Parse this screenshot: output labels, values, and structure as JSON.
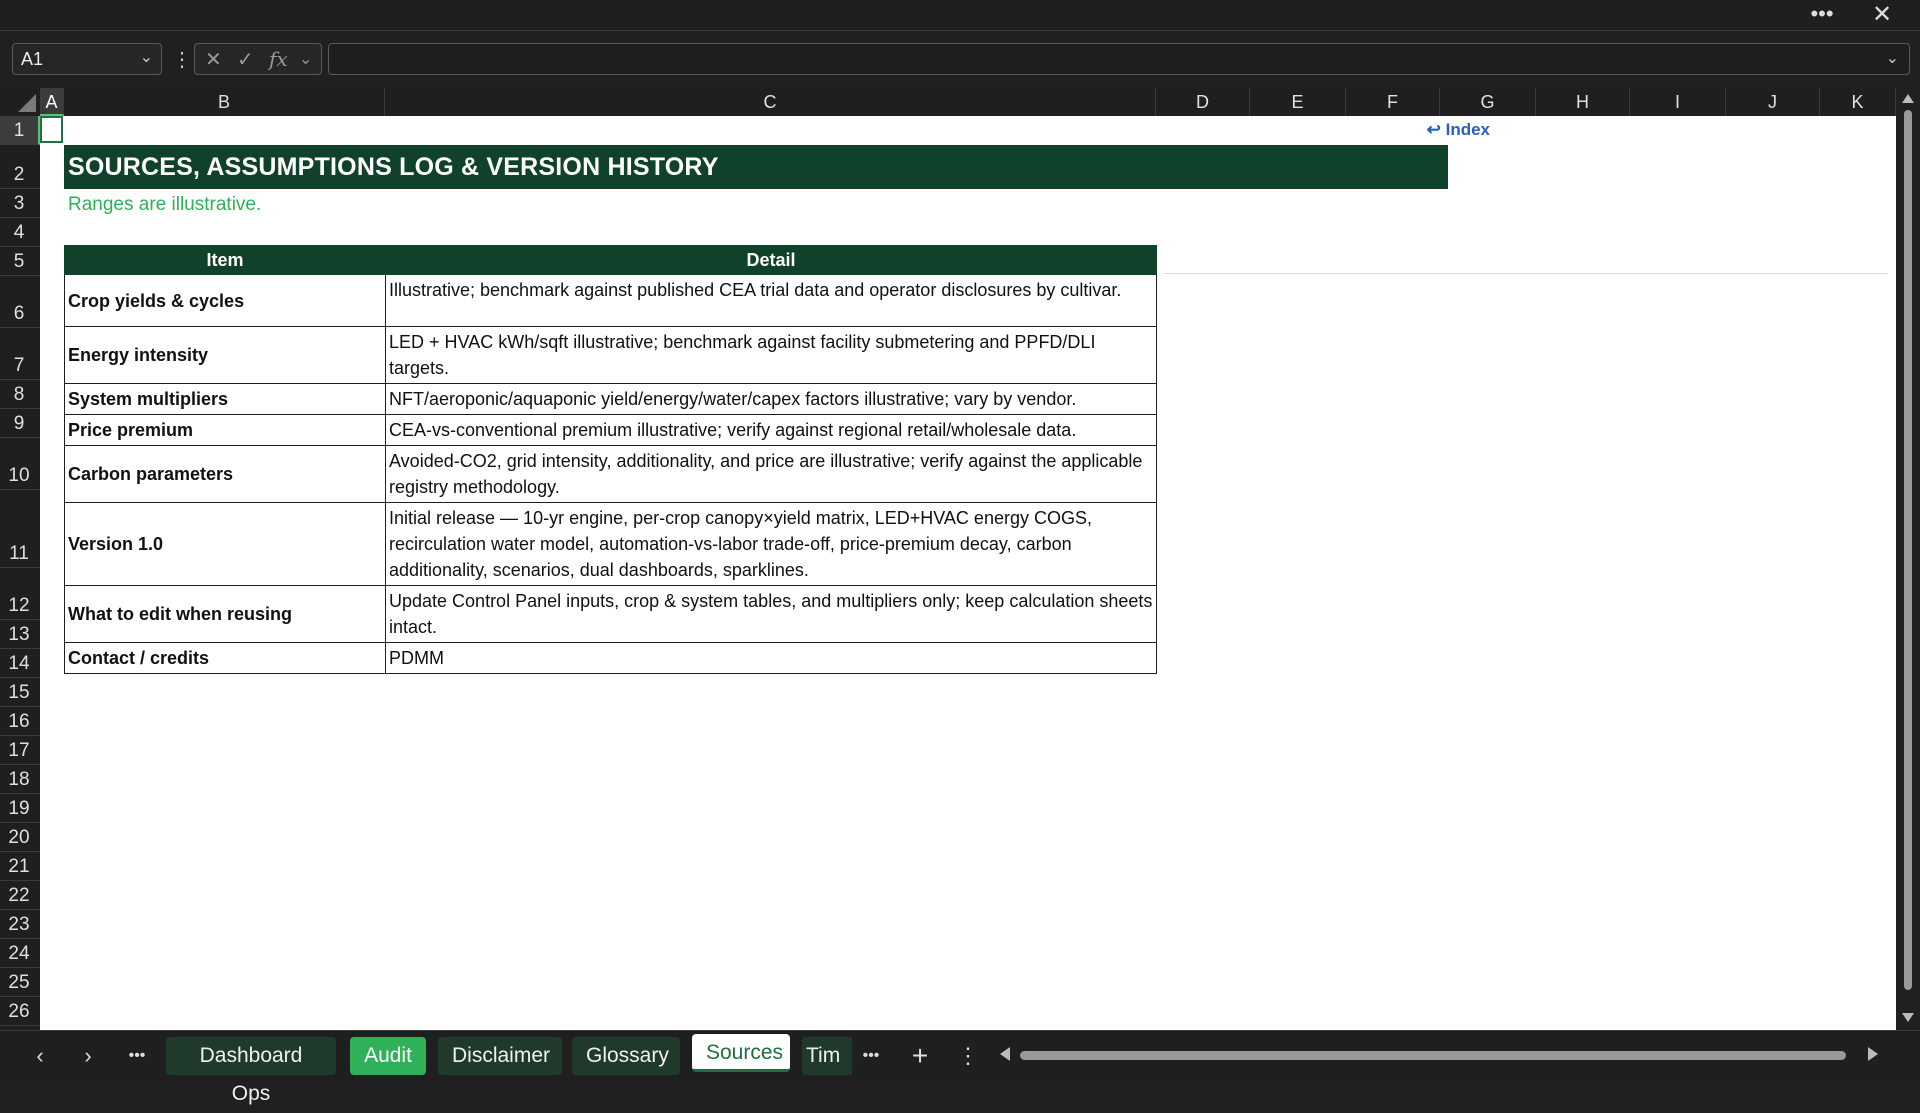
{
  "window": {
    "more_label": "•••",
    "close_label": "✕"
  },
  "formula_bar": {
    "name_box": "A1",
    "cancel_icon": "✕",
    "enter_icon": "✓",
    "fx_label": "fx",
    "formula": ""
  },
  "columns": [
    "A",
    "B",
    "C",
    "D",
    "E",
    "F",
    "G",
    "H",
    "I",
    "J",
    "K"
  ],
  "rows": [
    "1",
    "2",
    "3",
    "4",
    "5",
    "6",
    "7",
    "8",
    "9",
    "10",
    "11",
    "12",
    "13",
    "14",
    "15",
    "16",
    "17",
    "18",
    "19",
    "20",
    "21",
    "22",
    "23",
    "24",
    "25",
    "26"
  ],
  "sheet": {
    "index_link": "↩ Index",
    "title": "SOURCES, ASSUMPTIONS LOG & VERSION HISTORY",
    "subtitle": "Ranges are illustrative.",
    "table": {
      "headers": [
        "Item",
        "Detail"
      ],
      "rows": [
        {
          "item": "Crop yields & cycles",
          "detail": "Illustrative; benchmark against published CEA trial data and operator disclosures by cultivar."
        },
        {
          "item": "Energy intensity",
          "detail": "LED + HVAC kWh/sqft illustrative; benchmark against facility submetering and PPFD/DLI targets."
        },
        {
          "item": "System multipliers",
          "detail": "NFT/aeroponic/aquaponic yield/energy/water/capex factors illustrative; vary by vendor."
        },
        {
          "item": "Price premium",
          "detail": "CEA-vs-conventional premium illustrative; verify against regional retail/wholesale data."
        },
        {
          "item": "Carbon parameters",
          "detail": "Avoided-CO2, grid intensity, additionality, and price are illustrative; verify against the applicable registry methodology."
        },
        {
          "item": "Version 1.0",
          "detail": "Initial release — 10-yr engine, per-crop canopy×yield matrix, LED+HVAC energy COGS, recirculation water model, automation-vs-labor trade-off, price-premium decay, carbon additionality, scenarios, dual dashboards, sparklines."
        },
        {
          "item": "What to edit when reusing",
          "detail": "Update Control Panel inputs, crop & system tables, and multipliers only; keep calculation sheets intact."
        },
        {
          "item": "Contact / credits",
          "detail": "PDMM"
        }
      ]
    }
  },
  "tabs": [
    {
      "label": "Dashboard Ops",
      "style": "dark"
    },
    {
      "label": "Audit",
      "style": "green"
    },
    {
      "label": "Disclaimer",
      "style": "dark"
    },
    {
      "label": "Glossary",
      "style": "dark"
    },
    {
      "label": "Sources",
      "style": "active"
    },
    {
      "label": "Tim",
      "style": "dark"
    }
  ],
  "tab_nav": {
    "prev": "‹",
    "next": "›",
    "more": "•••",
    "more2": "•••",
    "add": "+",
    "menu": "⋮"
  }
}
